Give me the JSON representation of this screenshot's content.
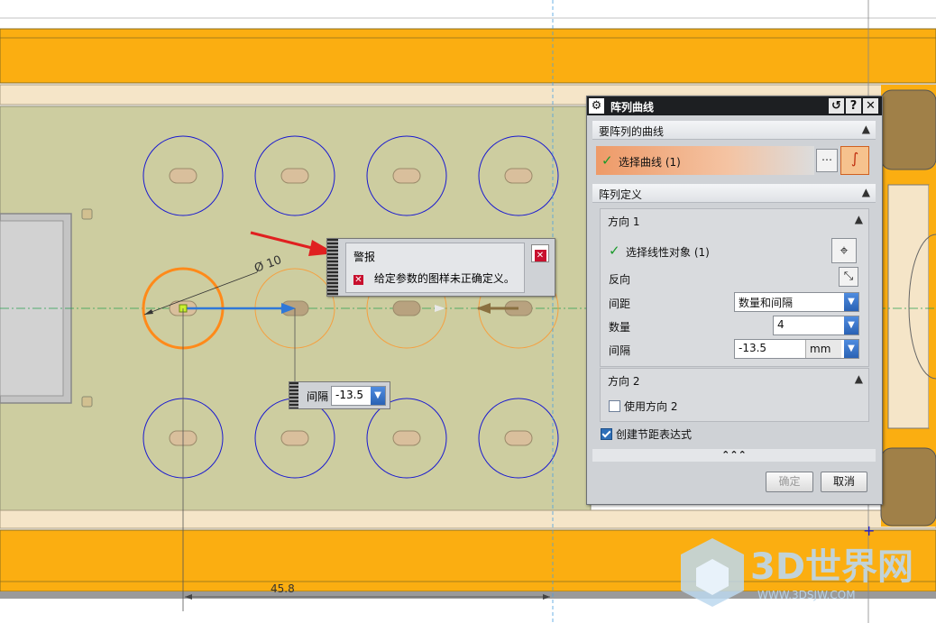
{
  "drawing": {
    "dimension_label": "45.8",
    "diameter_label": "Ø 10"
  },
  "dialog": {
    "title": "阵列曲线",
    "title_buttons": [
      "↺",
      "?",
      "✕"
    ],
    "section_curves": "要阵列的曲线",
    "select_curve": "选择曲线 (1)",
    "section_pattern": "阵列定义",
    "direction1": {
      "header": "方向 1",
      "select_linear": "选择线性对象 (1)",
      "reverse_label": "反向",
      "spacing_label": "间距",
      "spacing_value": "数量和间隔",
      "count_label": "数量",
      "count_value": "4",
      "pitch_label": "间隔",
      "pitch_value": "-13.5",
      "pitch_unit": "mm"
    },
    "direction2": {
      "header": "方向 2",
      "use_direction2": "使用方向 2",
      "use_direction2_checked": false
    },
    "create_expression": "创建节距表达式",
    "create_expression_checked": true,
    "more_label": "⌃⌃⌃",
    "ok_label": "确定",
    "cancel_label": "取消"
  },
  "warning": {
    "title": "警报",
    "message": "给定参数的图样未正确定义。"
  },
  "tooltip": {
    "label": "间隔",
    "value": "-13.5"
  },
  "watermark": {
    "text": "3D世界网",
    "url": "WWW.3DSJW.COM"
  },
  "colors": {
    "orange": "#fbae11",
    "plate": "#cdcda0",
    "circle": "#1a1ad0",
    "selected": "#ff8a1a",
    "accent_blue": "#2f78d8",
    "titlebar": "#1d1f22"
  }
}
